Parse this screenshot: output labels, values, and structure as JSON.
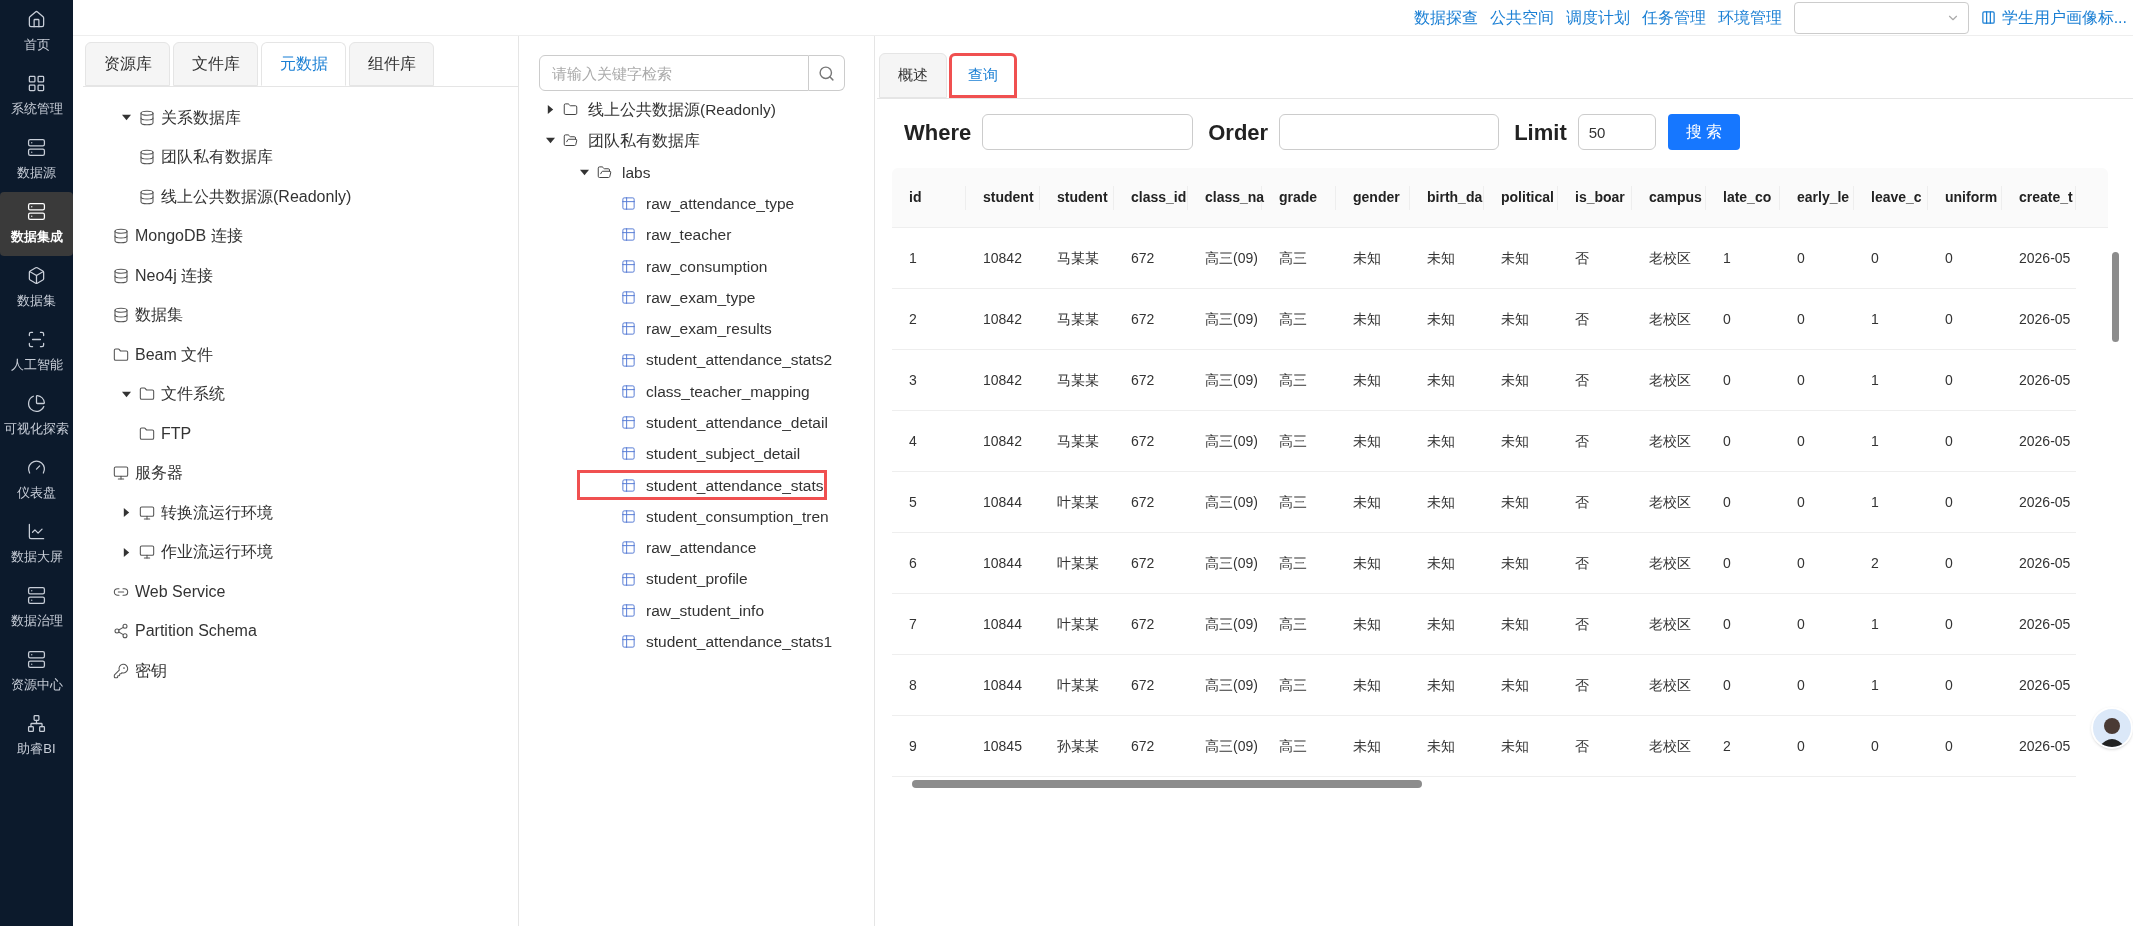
{
  "nav": [
    {
      "label": "首页",
      "selected": false
    },
    {
      "label": "系统管理",
      "selected": false
    },
    {
      "label": "数据源",
      "selected": false
    },
    {
      "label": "数据集成",
      "selected": true
    },
    {
      "label": "数据集",
      "selected": false
    },
    {
      "label": "人工智能",
      "selected": false
    },
    {
      "label": "可视化探索",
      "selected": false
    },
    {
      "label": "仪表盘",
      "selected": false
    },
    {
      "label": "数据大屏",
      "selected": false
    },
    {
      "label": "数据治理",
      "selected": false
    },
    {
      "label": "资源中心",
      "selected": false
    },
    {
      "label": "助睿BI",
      "selected": false
    }
  ],
  "header": {
    "links": [
      "数据探查",
      "公共空间",
      "调度计划",
      "任务管理",
      "环境管理"
    ],
    "project": "学生用户画像标..."
  },
  "left_panel": {
    "tabs": [
      {
        "label": "资源库",
        "selected": false
      },
      {
        "label": "文件库",
        "selected": false
      },
      {
        "label": "元数据",
        "selected": true
      },
      {
        "label": "组件库",
        "selected": false
      }
    ],
    "tree": [
      {
        "label": "关系数据库",
        "kind": "database",
        "expanded": true,
        "children": [
          {
            "label": "团队私有数据库",
            "kind": "database"
          },
          {
            "label": "线上公共数据源(Readonly)",
            "kind": "database"
          }
        ]
      },
      {
        "label": "MongoDB 连接",
        "kind": "database"
      },
      {
        "label": "Neo4j 连接",
        "kind": "database"
      },
      {
        "label": "数据集",
        "kind": "database"
      },
      {
        "label": "Beam 文件",
        "kind": "folder"
      },
      {
        "label": "文件系统",
        "kind": "folder",
        "expanded": true,
        "children": [
          {
            "label": "FTP",
            "kind": "folder"
          }
        ]
      },
      {
        "label": "服务器",
        "kind": "monitor"
      },
      {
        "label": "转换流运行环境",
        "kind": "monitor",
        "expanded": false
      },
      {
        "label": "作业流运行环境",
        "kind": "monitor",
        "expanded": false
      },
      {
        "label": "Web Service",
        "kind": "link"
      },
      {
        "label": "Partition Schema",
        "kind": "partition"
      },
      {
        "label": "密钥",
        "kind": "key"
      }
    ]
  },
  "middle_panel": {
    "search": {
      "placeholder": "请输入关键字检索"
    },
    "tree": [
      {
        "label": "线上公共数据源(Readonly)",
        "kind": "folder",
        "expanded": false
      },
      {
        "label": "团队私有数据库",
        "kind": "folder-open",
        "expanded": true,
        "children": [
          {
            "label": "labs",
            "kind": "folder-open",
            "expanded": true,
            "children": [
              {
                "label": "raw_attendance_type",
                "kind": "table",
                "highlighted": false
              },
              {
                "label": "raw_teacher",
                "kind": "table",
                "highlighted": false
              },
              {
                "label": "raw_consumption",
                "kind": "table",
                "highlighted": false
              },
              {
                "label": "raw_exam_type",
                "kind": "table",
                "highlighted": false
              },
              {
                "label": "raw_exam_results",
                "kind": "table",
                "highlighted": false
              },
              {
                "label": "student_attendance_stats2",
                "kind": "table",
                "highlighted": false
              },
              {
                "label": "class_teacher_mapping",
                "kind": "table",
                "highlighted": false
              },
              {
                "label": "student_attendance_detail",
                "kind": "table",
                "highlighted": false
              },
              {
                "label": "student_subject_detail",
                "kind": "table",
                "highlighted": false
              },
              {
                "label": "student_attendance_stats",
                "kind": "table",
                "highlighted": true
              },
              {
                "label": "student_consumption_tren",
                "kind": "table",
                "highlighted": false
              },
              {
                "label": "raw_attendance",
                "kind": "table",
                "highlighted": false
              },
              {
                "label": "student_profile",
                "kind": "table",
                "highlighted": false
              },
              {
                "label": "raw_student_info",
                "kind": "table",
                "highlighted": false
              },
              {
                "label": "student_attendance_stats1",
                "kind": "table",
                "highlighted": false
              }
            ]
          }
        ]
      }
    ]
  },
  "right_panel": {
    "tabs": [
      {
        "label": "概述",
        "selected": false,
        "highlighted": false
      },
      {
        "label": "查询",
        "selected": true,
        "highlighted": true
      }
    ],
    "query": {
      "where_label": "Where",
      "order_label": "Order",
      "limit_label": "Limit",
      "limit_value": "50",
      "search_button": "搜 索"
    },
    "table": {
      "columns": [
        "id",
        "student",
        "student",
        "class_id",
        "class_na",
        "grade",
        "gender",
        "birth_da",
        "political",
        "is_boar",
        "campus",
        "late_co",
        "early_le",
        "leave_c",
        "uniform",
        "create_t"
      ],
      "rows": [
        {
          "cells": [
            "1",
            "10842",
            "马某某",
            "672",
            "高三(09)",
            "高三",
            "未知",
            "未知",
            "未知",
            "否",
            "老校区",
            "1",
            "0",
            "0",
            "0",
            "2026-05"
          ]
        },
        {
          "cells": [
            "2",
            "10842",
            "马某某",
            "672",
            "高三(09)",
            "高三",
            "未知",
            "未知",
            "未知",
            "否",
            "老校区",
            "0",
            "0",
            "1",
            "0",
            "2026-05"
          ]
        },
        {
          "cells": [
            "3",
            "10842",
            "马某某",
            "672",
            "高三(09)",
            "高三",
            "未知",
            "未知",
            "未知",
            "否",
            "老校区",
            "0",
            "0",
            "1",
            "0",
            "2026-05"
          ]
        },
        {
          "cells": [
            "4",
            "10842",
            "马某某",
            "672",
            "高三(09)",
            "高三",
            "未知",
            "未知",
            "未知",
            "否",
            "老校区",
            "0",
            "0",
            "1",
            "0",
            "2026-05"
          ]
        },
        {
          "cells": [
            "5",
            "10844",
            "叶某某",
            "672",
            "高三(09)",
            "高三",
            "未知",
            "未知",
            "未知",
            "否",
            "老校区",
            "0",
            "0",
            "1",
            "0",
            "2026-05"
          ]
        },
        {
          "cells": [
            "6",
            "10844",
            "叶某某",
            "672",
            "高三(09)",
            "高三",
            "未知",
            "未知",
            "未知",
            "否",
            "老校区",
            "0",
            "0",
            "2",
            "0",
            "2026-05"
          ]
        },
        {
          "cells": [
            "7",
            "10844",
            "叶某某",
            "672",
            "高三(09)",
            "高三",
            "未知",
            "未知",
            "未知",
            "否",
            "老校区",
            "0",
            "0",
            "1",
            "0",
            "2026-05"
          ]
        },
        {
          "cells": [
            "8",
            "10844",
            "叶某某",
            "672",
            "高三(09)",
            "高三",
            "未知",
            "未知",
            "未知",
            "否",
            "老校区",
            "0",
            "0",
            "1",
            "0",
            "2026-05"
          ]
        },
        {
          "cells": [
            "9",
            "10845",
            "孙某某",
            "672",
            "高三(09)",
            "高三",
            "未知",
            "未知",
            "未知",
            "否",
            "老校区",
            "2",
            "0",
            "0",
            "0",
            "2026-05"
          ]
        }
      ]
    }
  }
}
